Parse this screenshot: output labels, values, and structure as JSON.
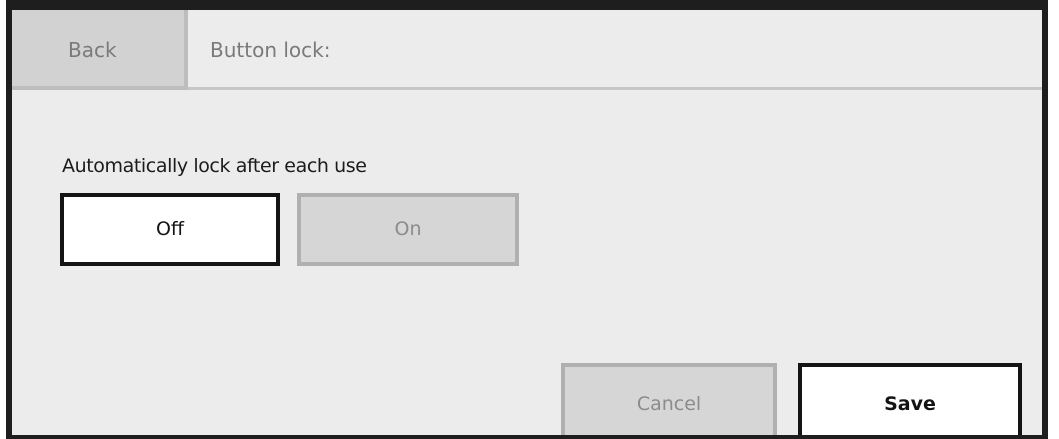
{
  "header": {
    "back_label": "Back",
    "title": "Button lock:"
  },
  "setting": {
    "label": "Automatically lock after each use",
    "options": [
      {
        "label": "Off",
        "selected": true
      },
      {
        "label": "On",
        "selected": false
      }
    ]
  },
  "actions": {
    "cancel_label": "Cancel",
    "save_label": "Save"
  },
  "colors": {
    "selected_border": "#141414",
    "unselected_border": "#b0b0b0",
    "panel_background": "#ececec",
    "inactive_fill": "#d6d6d6"
  }
}
